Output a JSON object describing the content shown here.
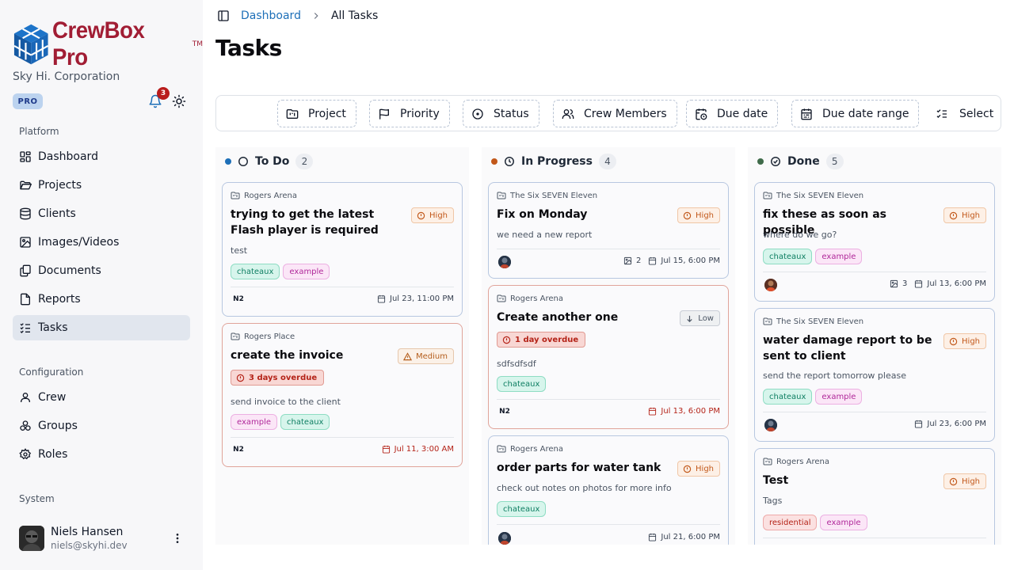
{
  "brand": {
    "name": "CrewBox Pro",
    "tm": "TM",
    "company": "Sky Hi. Corporation",
    "plan": "PRO"
  },
  "notifications": {
    "count": "3"
  },
  "sidebar": {
    "platform_label": "Platform",
    "platform": [
      {
        "label": "Dashboard",
        "icon": "dashboard-icon"
      },
      {
        "label": "Projects",
        "icon": "folder-icon"
      },
      {
        "label": "Clients",
        "icon": "database-icon"
      },
      {
        "label": "Images/Videos",
        "icon": "image-icon"
      },
      {
        "label": "Documents",
        "icon": "documents-icon"
      },
      {
        "label": "Reports",
        "icon": "report-icon"
      },
      {
        "label": "Tasks",
        "icon": "tasks-icon",
        "active": true
      }
    ],
    "config_label": "Configuration",
    "config": [
      {
        "label": "Crew",
        "icon": "user-icon"
      },
      {
        "label": "Groups",
        "icon": "groups-icon"
      },
      {
        "label": "Roles",
        "icon": "gear-icon"
      }
    ],
    "system_label": "System"
  },
  "user": {
    "name": "Niels Hansen",
    "email": "niels@skyhi.dev"
  },
  "breadcrumb": {
    "home": "Dashboard",
    "current": "All Tasks"
  },
  "page_title": "Tasks",
  "filters": {
    "project": "Project",
    "priority": "Priority",
    "status": "Status",
    "crew": "Crew Members",
    "due_date": "Due date",
    "due_range": "Due date range",
    "select": "Select"
  },
  "columns": {
    "todo": {
      "title": "To Do",
      "count": "2",
      "color": "#1d6fb8",
      "cards": [
        {
          "project": "Rogers Arena",
          "title": "trying to get the latest Flash player is required",
          "priority": "High",
          "description": "test",
          "tags": [
            "chateaux",
            "example"
          ],
          "assignee": "N2",
          "due": "Jul 23, 11:00 PM"
        },
        {
          "project": "Rogers Place",
          "title": "create the invoice",
          "priority": "Medium",
          "overdue": "3 days overdue",
          "description": "send invoice to the client",
          "tags": [
            "example",
            "chateaux"
          ],
          "assignee": "N2",
          "due": "Jul 11, 3:00 AM"
        }
      ]
    },
    "progress": {
      "title": "In Progress",
      "count": "4",
      "color": "#c2581a",
      "cards": [
        {
          "project": "The Six SEVEN Eleven",
          "title": "Fix on Monday",
          "priority": "High",
          "description": "we need a new report",
          "images": "2",
          "due": "Jul 15, 6:00 PM"
        },
        {
          "project": "Rogers Arena",
          "title": "Create another one",
          "priority": "Low",
          "overdue": "1 day overdue",
          "description": "sdfsdfsdf",
          "tags": [
            "chateaux"
          ],
          "assignee": "N2",
          "due": "Jul 13, 6:00 PM"
        },
        {
          "project": "Rogers Arena",
          "title": "order parts for water tank",
          "priority": "High",
          "description": "check out notes on photos for more info",
          "tags": [
            "chateaux"
          ],
          "due": "Jul 21, 6:00 PM"
        }
      ]
    },
    "done": {
      "title": "Done",
      "count": "5",
      "color": "#3f6b4a",
      "cards": [
        {
          "project": "The Six SEVEN Eleven",
          "title": "fix these as soon as possible",
          "priority": "High",
          "description": "where do we go?",
          "tags": [
            "chateaux",
            "example"
          ],
          "images": "3",
          "due": "Jul 13, 6:00 PM"
        },
        {
          "project": "The Six SEVEN Eleven",
          "title": "water damage report to be sent to client",
          "priority": "High",
          "description": "send the report tomorrow please",
          "tags": [
            "chateaux",
            "example"
          ],
          "due": "Jul 23, 6:00 PM"
        },
        {
          "project": "Rogers Arena",
          "title": "Test",
          "priority": "High",
          "description": "Tags",
          "tags": [
            "residential",
            "example"
          ]
        }
      ]
    }
  }
}
